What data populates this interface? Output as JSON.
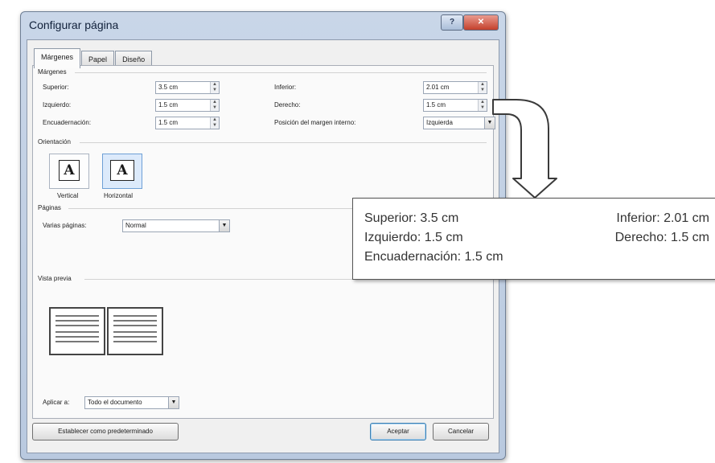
{
  "window": {
    "title": "Configurar página",
    "help_glyph": "?",
    "close_glyph": "✕"
  },
  "tabs": [
    {
      "label": "Márgenes",
      "active": true
    },
    {
      "label": "Papel",
      "active": false
    },
    {
      "label": "Diseño",
      "active": false
    }
  ],
  "margins": {
    "section": "Márgenes",
    "top": {
      "label": "Superior:",
      "value": "3.5 cm"
    },
    "bottom": {
      "label": "Inferior:",
      "value": "2.01 cm"
    },
    "left": {
      "label": "Izquierdo:",
      "value": "1.5 cm"
    },
    "right": {
      "label": "Derecho:",
      "value": "1.5 cm"
    },
    "gutter": {
      "label": "Encuadernación:",
      "value": "1.5 cm"
    },
    "gutter_pos": {
      "label": "Posición del margen interno:",
      "value": "Izquierda"
    }
  },
  "orientation": {
    "section": "Orientación",
    "glyph": "A",
    "vertical_label": "Vertical",
    "horizontal_label": "Horizontal",
    "selected": "horizontal"
  },
  "pages": {
    "section": "Páginas",
    "multiple_label": "Varias páginas:",
    "multiple_value": "Normal"
  },
  "preview": {
    "section": "Vista previa",
    "apply_label": "Aplicar a:",
    "apply_value": "Todo el documento"
  },
  "buttons": {
    "default": "Establecer como predeterminado",
    "ok": "Aceptar",
    "cancel": "Cancelar"
  },
  "callout": {
    "top": "Superior: 3.5 cm",
    "bottom": "Inferior: 2.01 cm",
    "left": "Izquierdo: 1.5 cm",
    "right": "Derecho: 1.5 cm",
    "gutter": "Encuadernación: 1.5 cm"
  },
  "colors": {
    "titlebar": "#c9d6e8",
    "close_button": "#c4402c",
    "selected_orientation": "#dceafb"
  }
}
